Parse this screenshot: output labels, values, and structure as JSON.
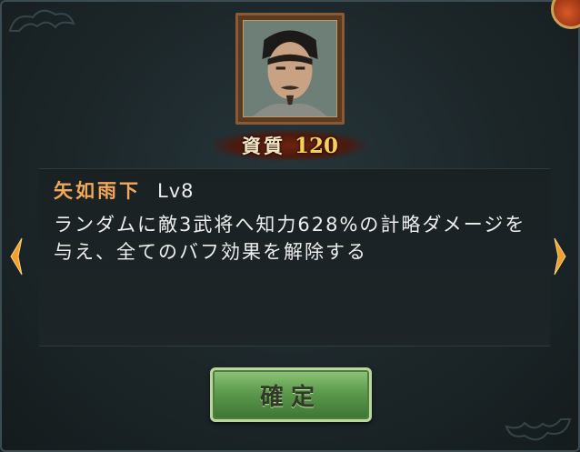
{
  "general": {
    "portrait_alt": "",
    "aptitude_label": "資質",
    "aptitude_value": "120"
  },
  "skill": {
    "name": "矢如雨下",
    "level": "Lv8",
    "description": "ランダムに敵3武将へ知力628%の計略ダメージを与え、全てのバフ効果を解除する"
  },
  "navigation": {
    "prev_icon": "chevron-left-icon",
    "next_icon": "chevron-right-icon"
  },
  "actions": {
    "confirm_label": "確定"
  },
  "colors": {
    "skill_name": "#f0a75a",
    "aptitude_value": "#f7cf5b",
    "confirm_button": "#5c9a4c",
    "arrow": "#f0a030"
  }
}
